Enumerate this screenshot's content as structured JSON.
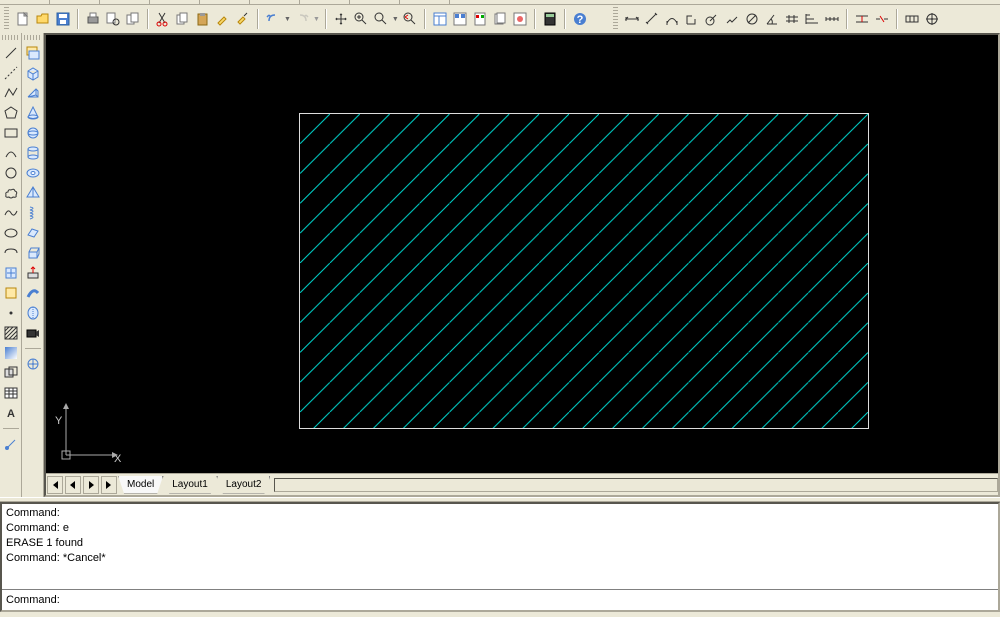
{
  "toolbar_top": {
    "icons_group1": [
      "new-file",
      "open-file",
      "save",
      "print",
      "print-preview",
      "publish",
      "cut",
      "copy",
      "paste",
      "match-prop",
      "paint"
    ],
    "icons_group2": [
      "undo",
      "redo"
    ],
    "icons_group3": [
      "pan",
      "zoom-realtime",
      "zoom-window",
      "zoom-previous"
    ],
    "icons_group4": [
      "properties",
      "design-center",
      "tool-palettes",
      "sheet-set",
      "markup",
      "calc",
      "help"
    ],
    "icons_dim": [
      "dim-linear",
      "dim-aligned",
      "dim-arc",
      "dim-ordinate",
      "dim-radius",
      "dim-jogged",
      "dim-diameter",
      "dim-angular",
      "dim-quick",
      "dim-baseline",
      "dim-continue",
      "dim-spacing",
      "dim-break",
      "dim-tolerance",
      "dim-center"
    ]
  },
  "left_col1": [
    "line",
    "construction-line",
    "polyline",
    "polygon",
    "rectangle",
    "arc",
    "circle",
    "revcloud",
    "spline",
    "ellipse",
    "ellipse-arc",
    "insert-block",
    "make-block",
    "point",
    "hatch",
    "gradient",
    "region",
    "table",
    "mtext"
  ],
  "left_col2": [
    "3d-box",
    "3d-wedge",
    "3d-cone",
    "3d-sphere",
    "3d-cylinder",
    "3d-torus",
    "3d-pyramid",
    "3d-helix",
    "3d-planar",
    "3d-extrude",
    "3d-presspull",
    "3d-sweep",
    "3d-revolve",
    "3d-loft",
    "3d-union",
    "3d-subtract"
  ],
  "tabs": {
    "model": "Model",
    "layout1": "Layout1",
    "layout2": "Layout2"
  },
  "axis": {
    "x": "X",
    "y": "Y"
  },
  "command_history": "Command:\nCommand: e\nERASE 1 found\nCommand: *Cancel*",
  "command_prompt": "Command:",
  "command_value": ""
}
